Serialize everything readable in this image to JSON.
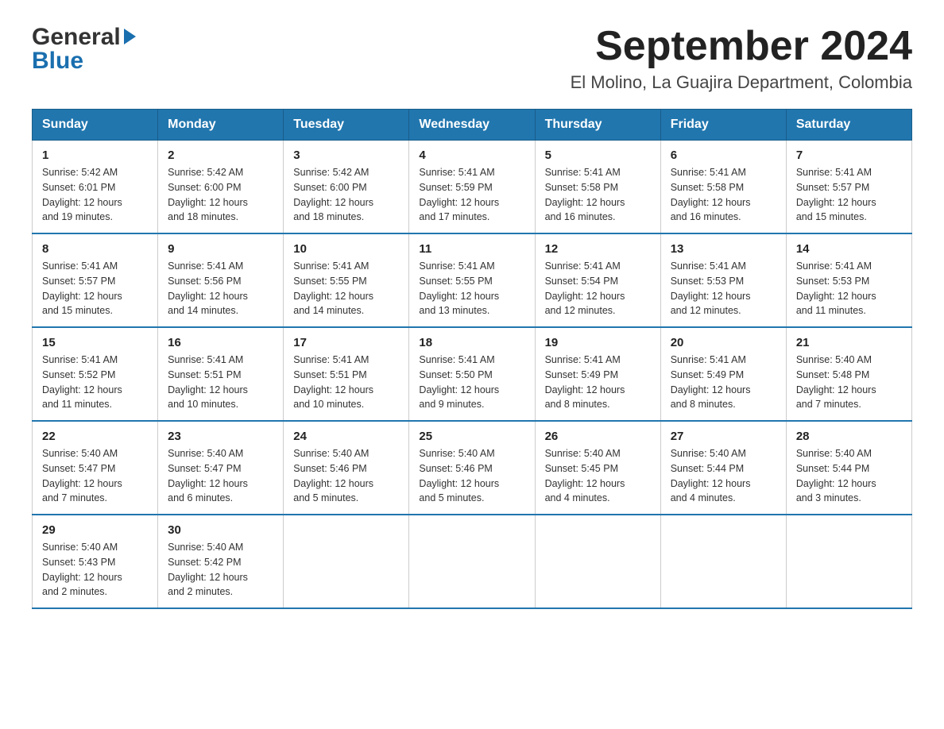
{
  "header": {
    "logo_general": "General",
    "logo_blue": "Blue",
    "title": "September 2024",
    "subtitle": "El Molino, La Guajira Department, Colombia"
  },
  "weekdays": [
    "Sunday",
    "Monday",
    "Tuesday",
    "Wednesday",
    "Thursday",
    "Friday",
    "Saturday"
  ],
  "weeks": [
    [
      {
        "day": "1",
        "sunrise": "5:42 AM",
        "sunset": "6:01 PM",
        "daylight": "12 hours and 19 minutes."
      },
      {
        "day": "2",
        "sunrise": "5:42 AM",
        "sunset": "6:00 PM",
        "daylight": "12 hours and 18 minutes."
      },
      {
        "day": "3",
        "sunrise": "5:42 AM",
        "sunset": "6:00 PM",
        "daylight": "12 hours and 18 minutes."
      },
      {
        "day": "4",
        "sunrise": "5:41 AM",
        "sunset": "5:59 PM",
        "daylight": "12 hours and 17 minutes."
      },
      {
        "day": "5",
        "sunrise": "5:41 AM",
        "sunset": "5:58 PM",
        "daylight": "12 hours and 16 minutes."
      },
      {
        "day": "6",
        "sunrise": "5:41 AM",
        "sunset": "5:58 PM",
        "daylight": "12 hours and 16 minutes."
      },
      {
        "day": "7",
        "sunrise": "5:41 AM",
        "sunset": "5:57 PM",
        "daylight": "12 hours and 15 minutes."
      }
    ],
    [
      {
        "day": "8",
        "sunrise": "5:41 AM",
        "sunset": "5:57 PM",
        "daylight": "12 hours and 15 minutes."
      },
      {
        "day": "9",
        "sunrise": "5:41 AM",
        "sunset": "5:56 PM",
        "daylight": "12 hours and 14 minutes."
      },
      {
        "day": "10",
        "sunrise": "5:41 AM",
        "sunset": "5:55 PM",
        "daylight": "12 hours and 14 minutes."
      },
      {
        "day": "11",
        "sunrise": "5:41 AM",
        "sunset": "5:55 PM",
        "daylight": "12 hours and 13 minutes."
      },
      {
        "day": "12",
        "sunrise": "5:41 AM",
        "sunset": "5:54 PM",
        "daylight": "12 hours and 12 minutes."
      },
      {
        "day": "13",
        "sunrise": "5:41 AM",
        "sunset": "5:53 PM",
        "daylight": "12 hours and 12 minutes."
      },
      {
        "day": "14",
        "sunrise": "5:41 AM",
        "sunset": "5:53 PM",
        "daylight": "12 hours and 11 minutes."
      }
    ],
    [
      {
        "day": "15",
        "sunrise": "5:41 AM",
        "sunset": "5:52 PM",
        "daylight": "12 hours and 11 minutes."
      },
      {
        "day": "16",
        "sunrise": "5:41 AM",
        "sunset": "5:51 PM",
        "daylight": "12 hours and 10 minutes."
      },
      {
        "day": "17",
        "sunrise": "5:41 AM",
        "sunset": "5:51 PM",
        "daylight": "12 hours and 10 minutes."
      },
      {
        "day": "18",
        "sunrise": "5:41 AM",
        "sunset": "5:50 PM",
        "daylight": "12 hours and 9 minutes."
      },
      {
        "day": "19",
        "sunrise": "5:41 AM",
        "sunset": "5:49 PM",
        "daylight": "12 hours and 8 minutes."
      },
      {
        "day": "20",
        "sunrise": "5:41 AM",
        "sunset": "5:49 PM",
        "daylight": "12 hours and 8 minutes."
      },
      {
        "day": "21",
        "sunrise": "5:40 AM",
        "sunset": "5:48 PM",
        "daylight": "12 hours and 7 minutes."
      }
    ],
    [
      {
        "day": "22",
        "sunrise": "5:40 AM",
        "sunset": "5:47 PM",
        "daylight": "12 hours and 7 minutes."
      },
      {
        "day": "23",
        "sunrise": "5:40 AM",
        "sunset": "5:47 PM",
        "daylight": "12 hours and 6 minutes."
      },
      {
        "day": "24",
        "sunrise": "5:40 AM",
        "sunset": "5:46 PM",
        "daylight": "12 hours and 5 minutes."
      },
      {
        "day": "25",
        "sunrise": "5:40 AM",
        "sunset": "5:46 PM",
        "daylight": "12 hours and 5 minutes."
      },
      {
        "day": "26",
        "sunrise": "5:40 AM",
        "sunset": "5:45 PM",
        "daylight": "12 hours and 4 minutes."
      },
      {
        "day": "27",
        "sunrise": "5:40 AM",
        "sunset": "5:44 PM",
        "daylight": "12 hours and 4 minutes."
      },
      {
        "day": "28",
        "sunrise": "5:40 AM",
        "sunset": "5:44 PM",
        "daylight": "12 hours and 3 minutes."
      }
    ],
    [
      {
        "day": "29",
        "sunrise": "5:40 AM",
        "sunset": "5:43 PM",
        "daylight": "12 hours and 2 minutes."
      },
      {
        "day": "30",
        "sunrise": "5:40 AM",
        "sunset": "5:42 PM",
        "daylight": "12 hours and 2 minutes."
      },
      null,
      null,
      null,
      null,
      null
    ]
  ],
  "labels": {
    "sunrise": "Sunrise:",
    "sunset": "Sunset:",
    "daylight": "Daylight:"
  }
}
